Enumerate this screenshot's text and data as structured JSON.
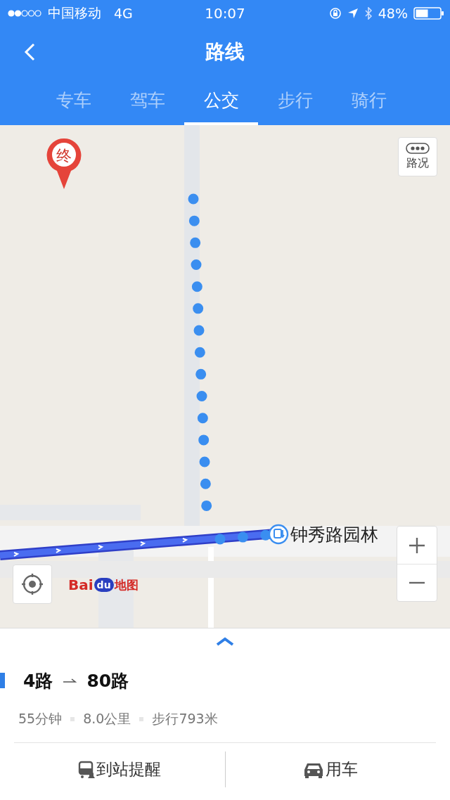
{
  "status_bar": {
    "carrier": "中国移动",
    "network": "4G",
    "time": "10:07",
    "battery": "48%"
  },
  "nav": {
    "title": "路线"
  },
  "tabs": [
    {
      "label": "专车",
      "selected": false
    },
    {
      "label": "驾车",
      "selected": false
    },
    {
      "label": "公交",
      "selected": true
    },
    {
      "label": "步行",
      "selected": false
    },
    {
      "label": "骑行",
      "selected": false
    }
  ],
  "map": {
    "end_marker": "终",
    "traffic_button": "路况",
    "station": "钟秀路园林",
    "logo": [
      "Bai",
      "du",
      "地图"
    ]
  },
  "route": {
    "segments": [
      "4路",
      "80路"
    ],
    "duration": "55分钟",
    "distance": "8.0公里",
    "walk": "步行793米"
  },
  "actions": [
    {
      "label": "到站提醒",
      "kind": "bus-alert"
    },
    {
      "label": "用车",
      "kind": "car"
    }
  ]
}
